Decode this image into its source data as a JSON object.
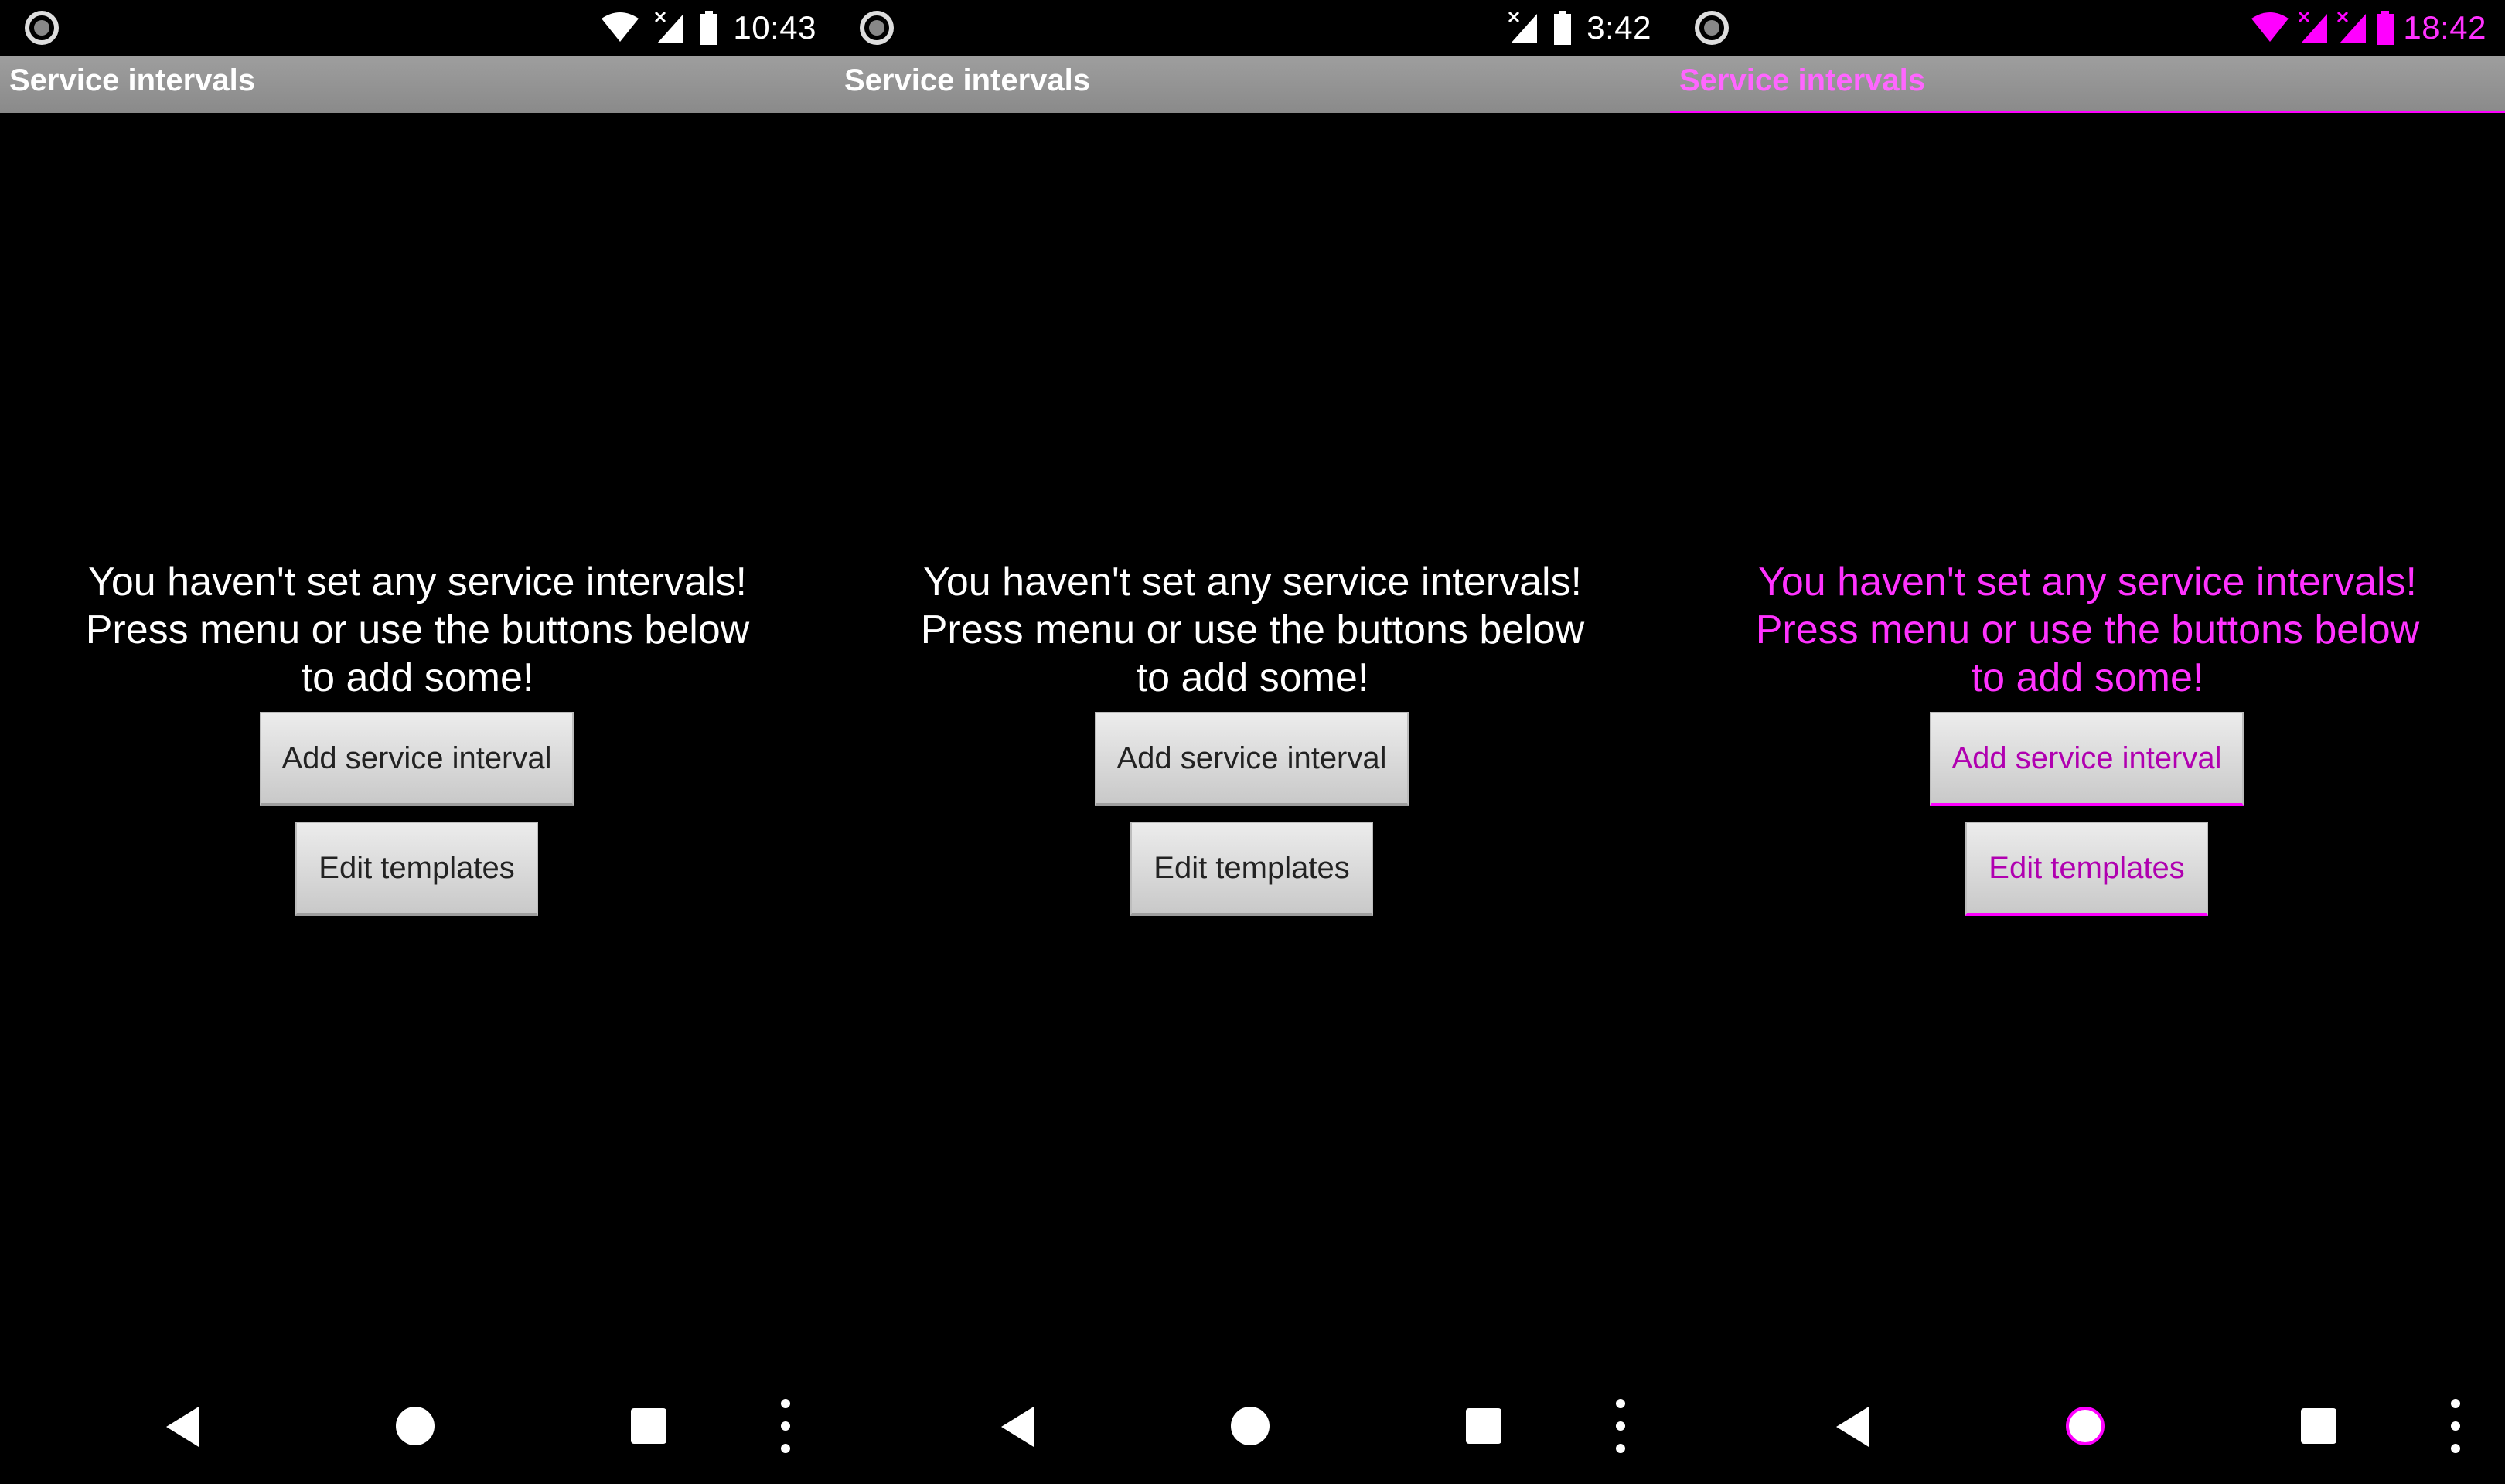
{
  "screens": [
    {
      "status_time": "10:43",
      "title": "Service intervals",
      "message_lines": [
        "You haven't set any service intervals!",
        "Press menu or use the buttons below",
        "to add some!"
      ],
      "add_button": "Add service interval",
      "edit_button": "Edit templates"
    },
    {
      "status_time": "3:42",
      "title": "Service intervals",
      "message_lines": [
        "You haven't set any service intervals!",
        "Press menu or use the buttons below",
        "to add some!"
      ],
      "add_button": "Add service interval",
      "edit_button": "Edit templates"
    },
    {
      "status_time": "18:42",
      "title": "Service intervals",
      "message_lines": [
        "You haven't set any service intervals!",
        "Press menu or use the buttons below",
        "to add some!"
      ],
      "add_button": "Add service interval",
      "edit_button": "Edit templates"
    }
  ],
  "colors": {
    "background": "#000000",
    "action_bar": "#999999",
    "text": "#ffffff",
    "accent_magenta": "#ff00ff",
    "button": "#dcdcdc"
  },
  "icons": [
    "notification-dot-icon",
    "wifi-icon",
    "no-signal-icon",
    "battery-icon",
    "back-icon",
    "home-icon",
    "recents-icon",
    "menu-dots-icon"
  ]
}
